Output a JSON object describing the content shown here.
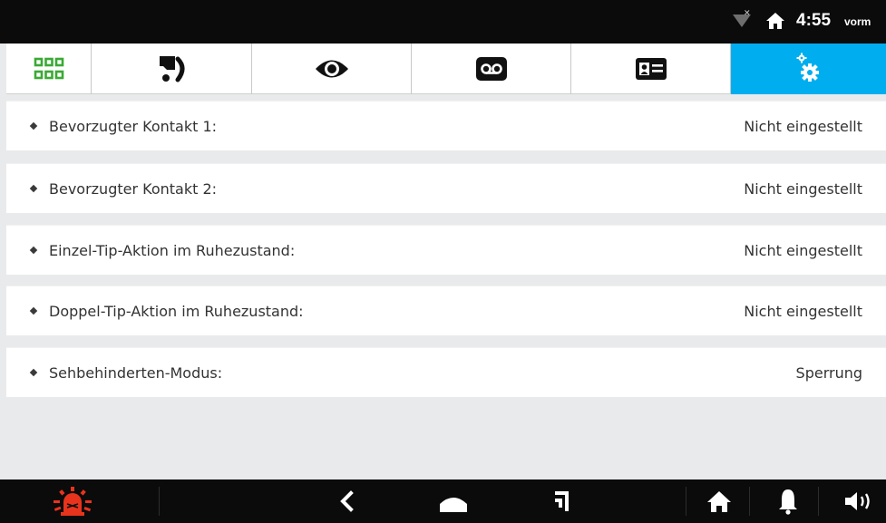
{
  "status_bar": {
    "time": "4:55",
    "ampm": "vorm"
  },
  "tabs": [
    {
      "icon": "apps-grid-icon",
      "active": false
    },
    {
      "icon": "intercom-call-icon",
      "active": false
    },
    {
      "icon": "eye-icon",
      "active": false
    },
    {
      "icon": "voicemail-icon",
      "active": false
    },
    {
      "icon": "contact-card-icon",
      "active": false
    },
    {
      "icon": "settings-gears-icon",
      "active": true
    }
  ],
  "settings": {
    "rows": [
      {
        "label": "Bevorzugter Kontakt 1:",
        "value": "Nicht eingestellt"
      },
      {
        "label": "Bevorzugter Kontakt 2:",
        "value": "Nicht eingestellt"
      },
      {
        "label": "Einzel-Tip-Aktion im Ruhezustand:",
        "value": "Nicht eingestellt"
      },
      {
        "label": "Doppel-Tip-Aktion im Ruhezustand:",
        "value": "Nicht eingestellt"
      },
      {
        "label": "Sehbehinderten-Modus:",
        "value": "Sperrung"
      }
    ]
  },
  "nav_bar": {
    "buttons": [
      "alarm-icon",
      "back-icon",
      "home-dome-icon",
      "recents-icon",
      "house-icon",
      "bell-icon",
      "volume-icon"
    ]
  },
  "colors": {
    "accent": "#00aeef",
    "grid_green": "#3aaa35",
    "alarm_red": "#e8341c",
    "bar_black": "#0b0b0b",
    "page_bg": "#e9eaeb"
  }
}
